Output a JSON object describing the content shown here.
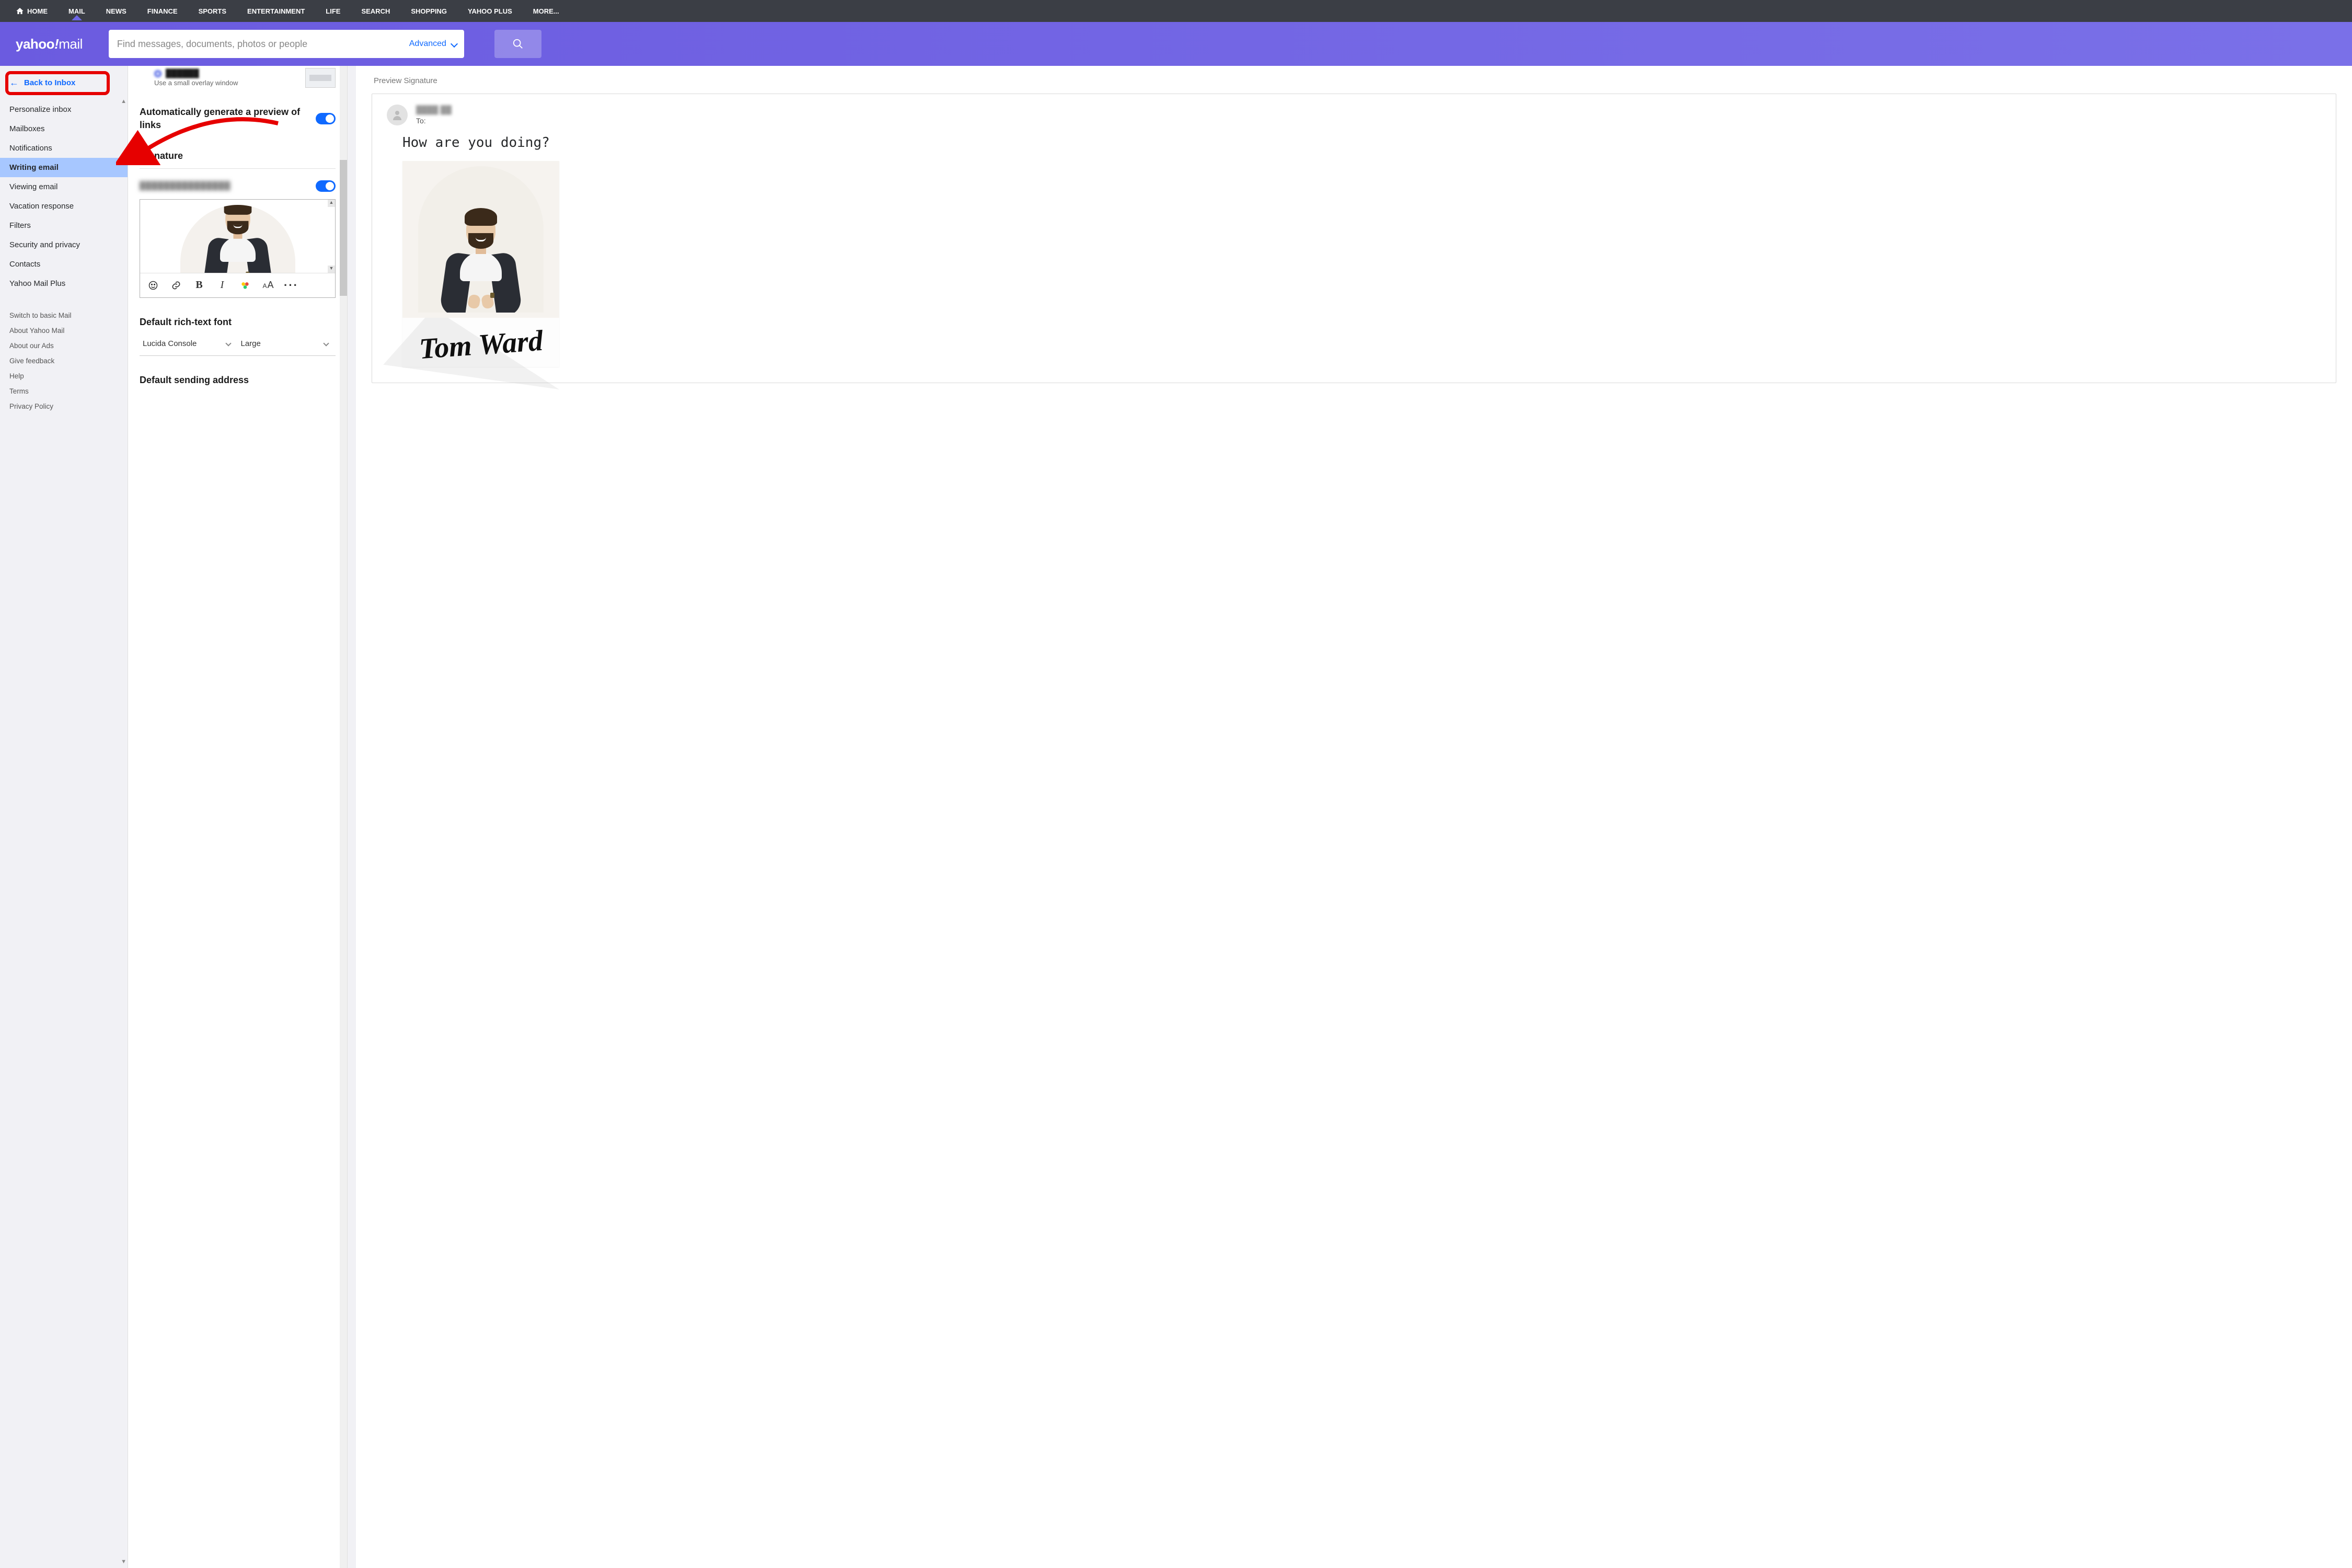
{
  "topnav": {
    "home": "HOME",
    "mail": "MAIL",
    "news": "NEWS",
    "finance": "FINANCE",
    "sports": "SPORTS",
    "entertainment": "ENTERTAINMENT",
    "life": "LIFE",
    "search": "SEARCH",
    "shopping": "SHOPPING",
    "plus": "YAHOO PLUS",
    "more": "MORE..."
  },
  "header": {
    "logo_brand": "yahoo",
    "logo_slash": "!",
    "logo_product": "mail",
    "search_placeholder": "Find messages, documents, photos or people",
    "advanced_label": "Advanced"
  },
  "sidebar": {
    "back_label": "Back to Inbox",
    "items": [
      "Personalize inbox",
      "Mailboxes",
      "Notifications",
      "Writing email",
      "Viewing email",
      "Vacation response",
      "Filters",
      "Security and privacy",
      "Contacts",
      "Yahoo Mail Plus"
    ],
    "active_index": 3,
    "secondary": [
      "Switch to basic Mail",
      "About Yahoo Mail",
      "About our Ads",
      "Give feedback",
      "Help",
      "Terms",
      "Privacy Policy"
    ]
  },
  "settings": {
    "compact_desc": "Use a small overlay window",
    "autopreview_title": "Automatically generate a preview of links",
    "autopreview_on": true,
    "signature_heading": "Signature",
    "signature_toggle_on": true,
    "default_font_heading": "Default rich-text font",
    "font_family": "Lucida Console",
    "font_size": "Large",
    "default_sending_heading": "Default sending address"
  },
  "toolbar_icons": {
    "emoji": "emoji-icon",
    "link": "link-icon",
    "bold": "B",
    "italic": "I",
    "color": "text-color-icon",
    "font": "font-size-icon",
    "more": "more-icon"
  },
  "preview": {
    "heading": "Preview Signature",
    "to_label": "To:",
    "body_text": "How are you doing?",
    "signature_name": "Tom Ward"
  },
  "colors": {
    "accent": "#0f69ff",
    "header1": "#6b5be0",
    "header2": "#7a70e8",
    "annot": "#e60000"
  }
}
